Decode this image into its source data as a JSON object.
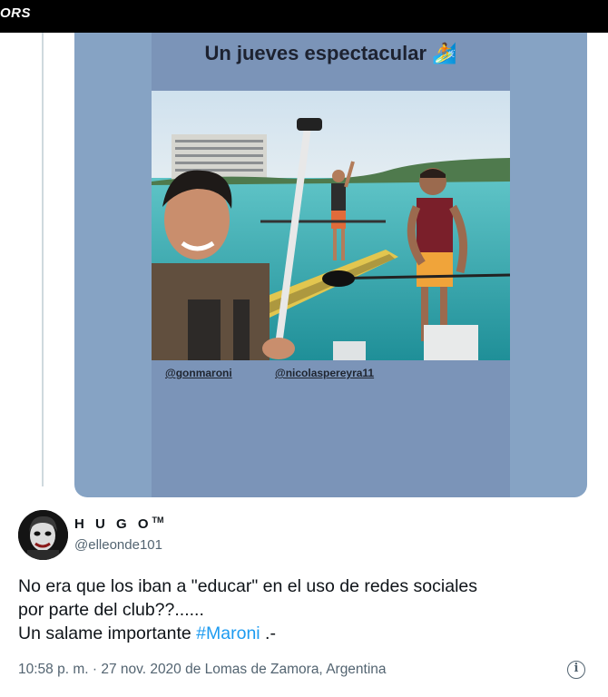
{
  "top_bar": {
    "label": "ORS"
  },
  "quoted_media": {
    "story_title": "Un jueves espectacular",
    "emoji": "🏄",
    "tags": [
      "@gonmaroni",
      "@nicolaspereyra11"
    ]
  },
  "tweet": {
    "display_name": "H U G O",
    "trademark": "TM",
    "handle": "@elleonde101",
    "text_line_1": "No era que los iban a \"educar\" en el uso de redes sociales",
    "text_line_2": "por parte del club??......",
    "text_line_3_prefix": "Un salame importante ",
    "hashtag": "#Maroni",
    "text_line_3_suffix": " .-",
    "meta": "10:58 p. m. · 27 nov. 2020 de Lomas de Zamora, Argentina",
    "info_glyph": "i"
  },
  "colors": {
    "accent": "#1d9bf0",
    "secondary_text": "#536471",
    "media_bg": "#86a3c4"
  }
}
